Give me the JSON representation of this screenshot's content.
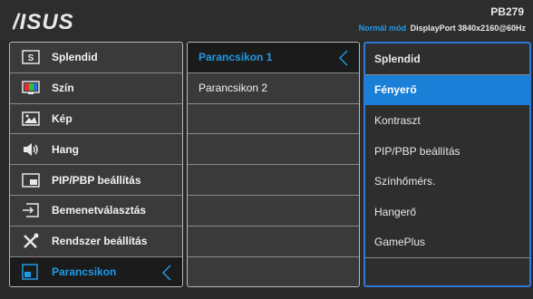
{
  "header": {
    "logo": "ASUS",
    "model": "PB279",
    "mode": "Normál mód",
    "input": "DisplayPort",
    "resolution": "3840x2160@60Hz"
  },
  "main_menu": [
    {
      "label": "Splendid",
      "icon": "splendid-icon"
    },
    {
      "label": "Szín",
      "icon": "color-icon"
    },
    {
      "label": "Kép",
      "icon": "image-icon"
    },
    {
      "label": "Hang",
      "icon": "speaker-icon"
    },
    {
      "label": "PIP/PBP beállítás",
      "icon": "pip-icon"
    },
    {
      "label": "Bemenetválasztás",
      "icon": "input-icon"
    },
    {
      "label": "Rendszer beállítás",
      "icon": "tools-icon"
    },
    {
      "label": "Parancsikon",
      "icon": "shortcut-icon",
      "active": true
    }
  ],
  "sub_menu": [
    {
      "label": "Parancsikon 1",
      "active": true
    },
    {
      "label": "Parancsikon 2"
    },
    {
      "label": ""
    },
    {
      "label": ""
    },
    {
      "label": ""
    },
    {
      "label": ""
    },
    {
      "label": ""
    },
    {
      "label": ""
    }
  ],
  "options": [
    {
      "label": "Splendid",
      "title": true
    },
    {
      "label": "Fényerő",
      "selected": true
    },
    {
      "label": "Kontraszt"
    },
    {
      "label": "PIP/PBP beállítás"
    },
    {
      "label": "Színhőmérs."
    },
    {
      "label": "Hangerő"
    },
    {
      "label": "GamePlus"
    },
    {
      "label": ""
    }
  ],
  "colors": {
    "accent": "#1f9ae6",
    "selection": "#1a7fd6"
  }
}
